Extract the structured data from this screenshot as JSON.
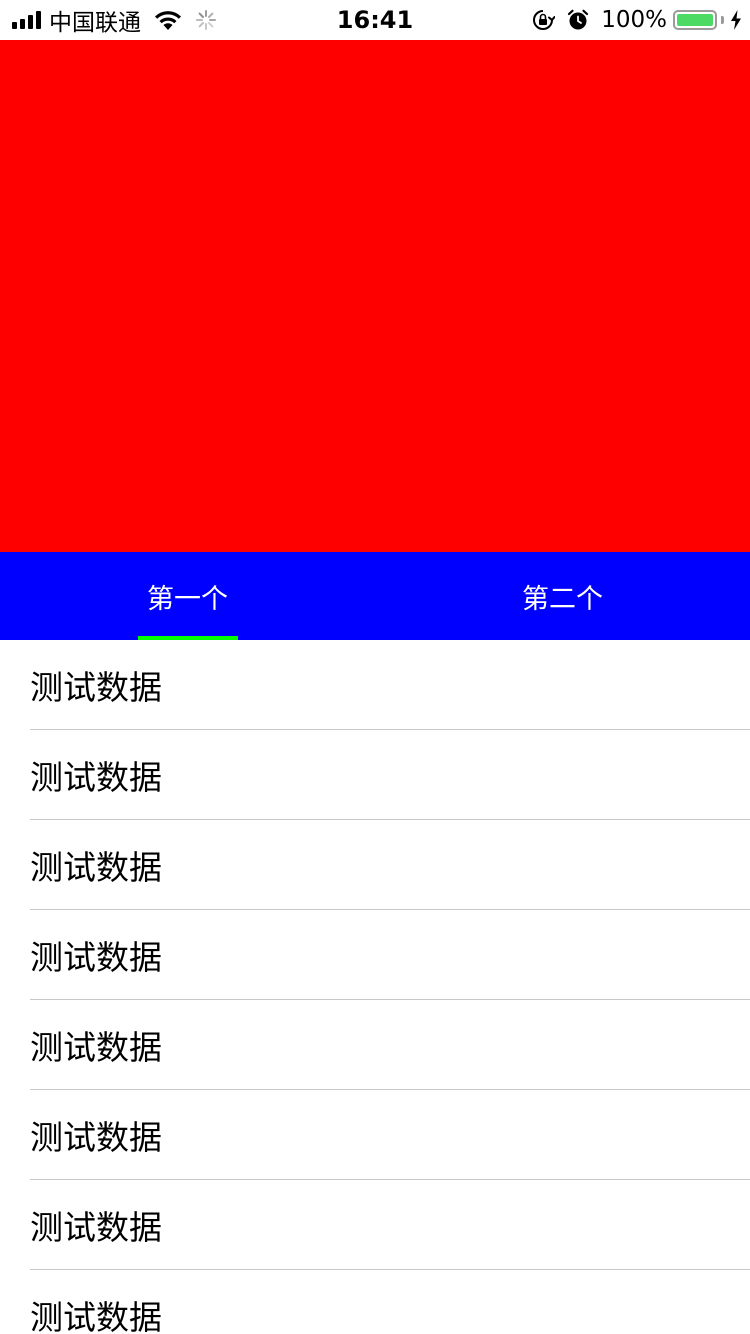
{
  "status_bar": {
    "carrier": "中国联通",
    "time": "16:41",
    "battery_percent": "100%",
    "battery_color": "#4cd964",
    "signal_icon": "cellular-signal-icon",
    "wifi_icon": "wifi-icon",
    "activity_icon": "loading-spinner-icon",
    "orientation_lock_icon": "rotation-lock-icon",
    "alarm_icon": "alarm-clock-icon",
    "charging_icon": "charging-bolt-icon"
  },
  "hero": {
    "color": "#ff0000"
  },
  "tabs": {
    "background": "#0000ff",
    "indicator_color": "#00ff00",
    "active_index": 0,
    "items": [
      {
        "label": "第一个"
      },
      {
        "label": "第二个"
      }
    ]
  },
  "list": {
    "items": [
      {
        "label": "测试数据"
      },
      {
        "label": "测试数据"
      },
      {
        "label": "测试数据"
      },
      {
        "label": "测试数据"
      },
      {
        "label": "测试数据"
      },
      {
        "label": "测试数据"
      },
      {
        "label": "测试数据"
      },
      {
        "label": "测试数据"
      }
    ]
  }
}
